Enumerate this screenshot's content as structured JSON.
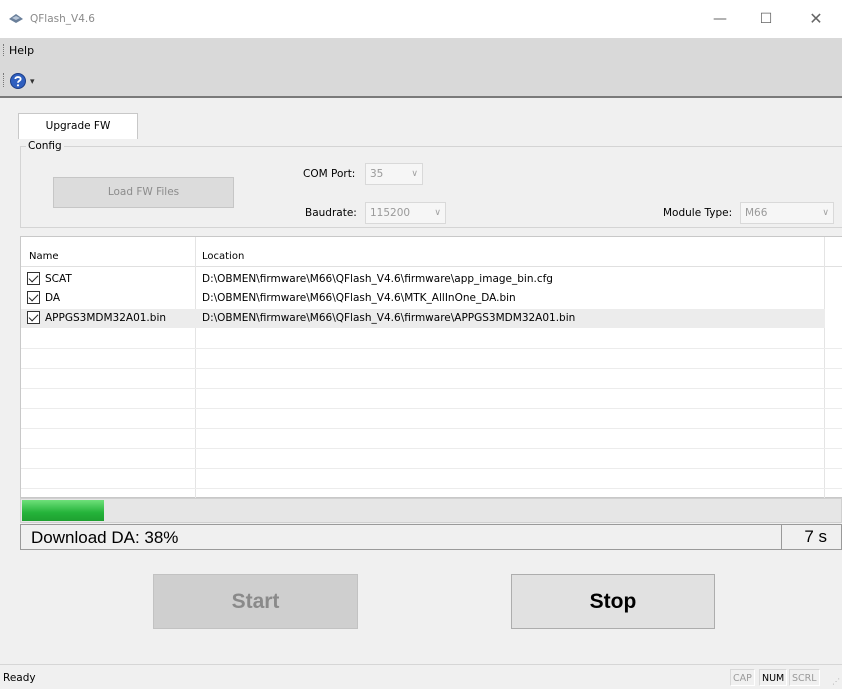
{
  "window": {
    "title": "QFlash_V4.6",
    "minimize_glyph": "—",
    "maximize_glyph": "☐",
    "close_glyph": "✕"
  },
  "menu": {
    "help": "Help"
  },
  "toolbar": {
    "help_icon": "help-icon",
    "overflow_glyph": "▾"
  },
  "tabs": [
    {
      "label": "Upgrade FW",
      "active": true
    }
  ],
  "config": {
    "legend": "Config",
    "load_button": "Load FW Files",
    "com_port_label": "COM Port:",
    "com_port_value": "35",
    "baudrate_label": "Baudrate:",
    "baudrate_value": "115200",
    "module_type_label": "Module Type:",
    "module_type_value": "M66",
    "dropdown_glyph": "∨"
  },
  "file_list": {
    "columns": [
      "Name",
      "Location"
    ],
    "rows": [
      {
        "checked": true,
        "name": "SCAT",
        "location": "D:\\OBMEN\\firmware\\M66\\QFlash_V4.6\\firmware\\app_image_bin.cfg"
      },
      {
        "checked": true,
        "name": "DA",
        "location": "D:\\OBMEN\\firmware\\M66\\QFlash_V4.6\\MTK_AllInOne_DA.bin"
      },
      {
        "checked": true,
        "name": "APPGS3MDM32A01.bin",
        "location": "D:\\OBMEN\\firmware\\M66\\QFlash_V4.6\\firmware\\APPGS3MDM32A01.bin",
        "selected": true
      }
    ]
  },
  "progress": {
    "fraction": 0.1,
    "status_text": "Download DA: 38%",
    "elapsed": "7 s",
    "fill_color": "#25b33a"
  },
  "actions": {
    "start": "Start",
    "stop": "Stop"
  },
  "statusbar": {
    "ready": "Ready",
    "cap": "CAP",
    "num": "NUM",
    "scrl": "SCRL"
  }
}
